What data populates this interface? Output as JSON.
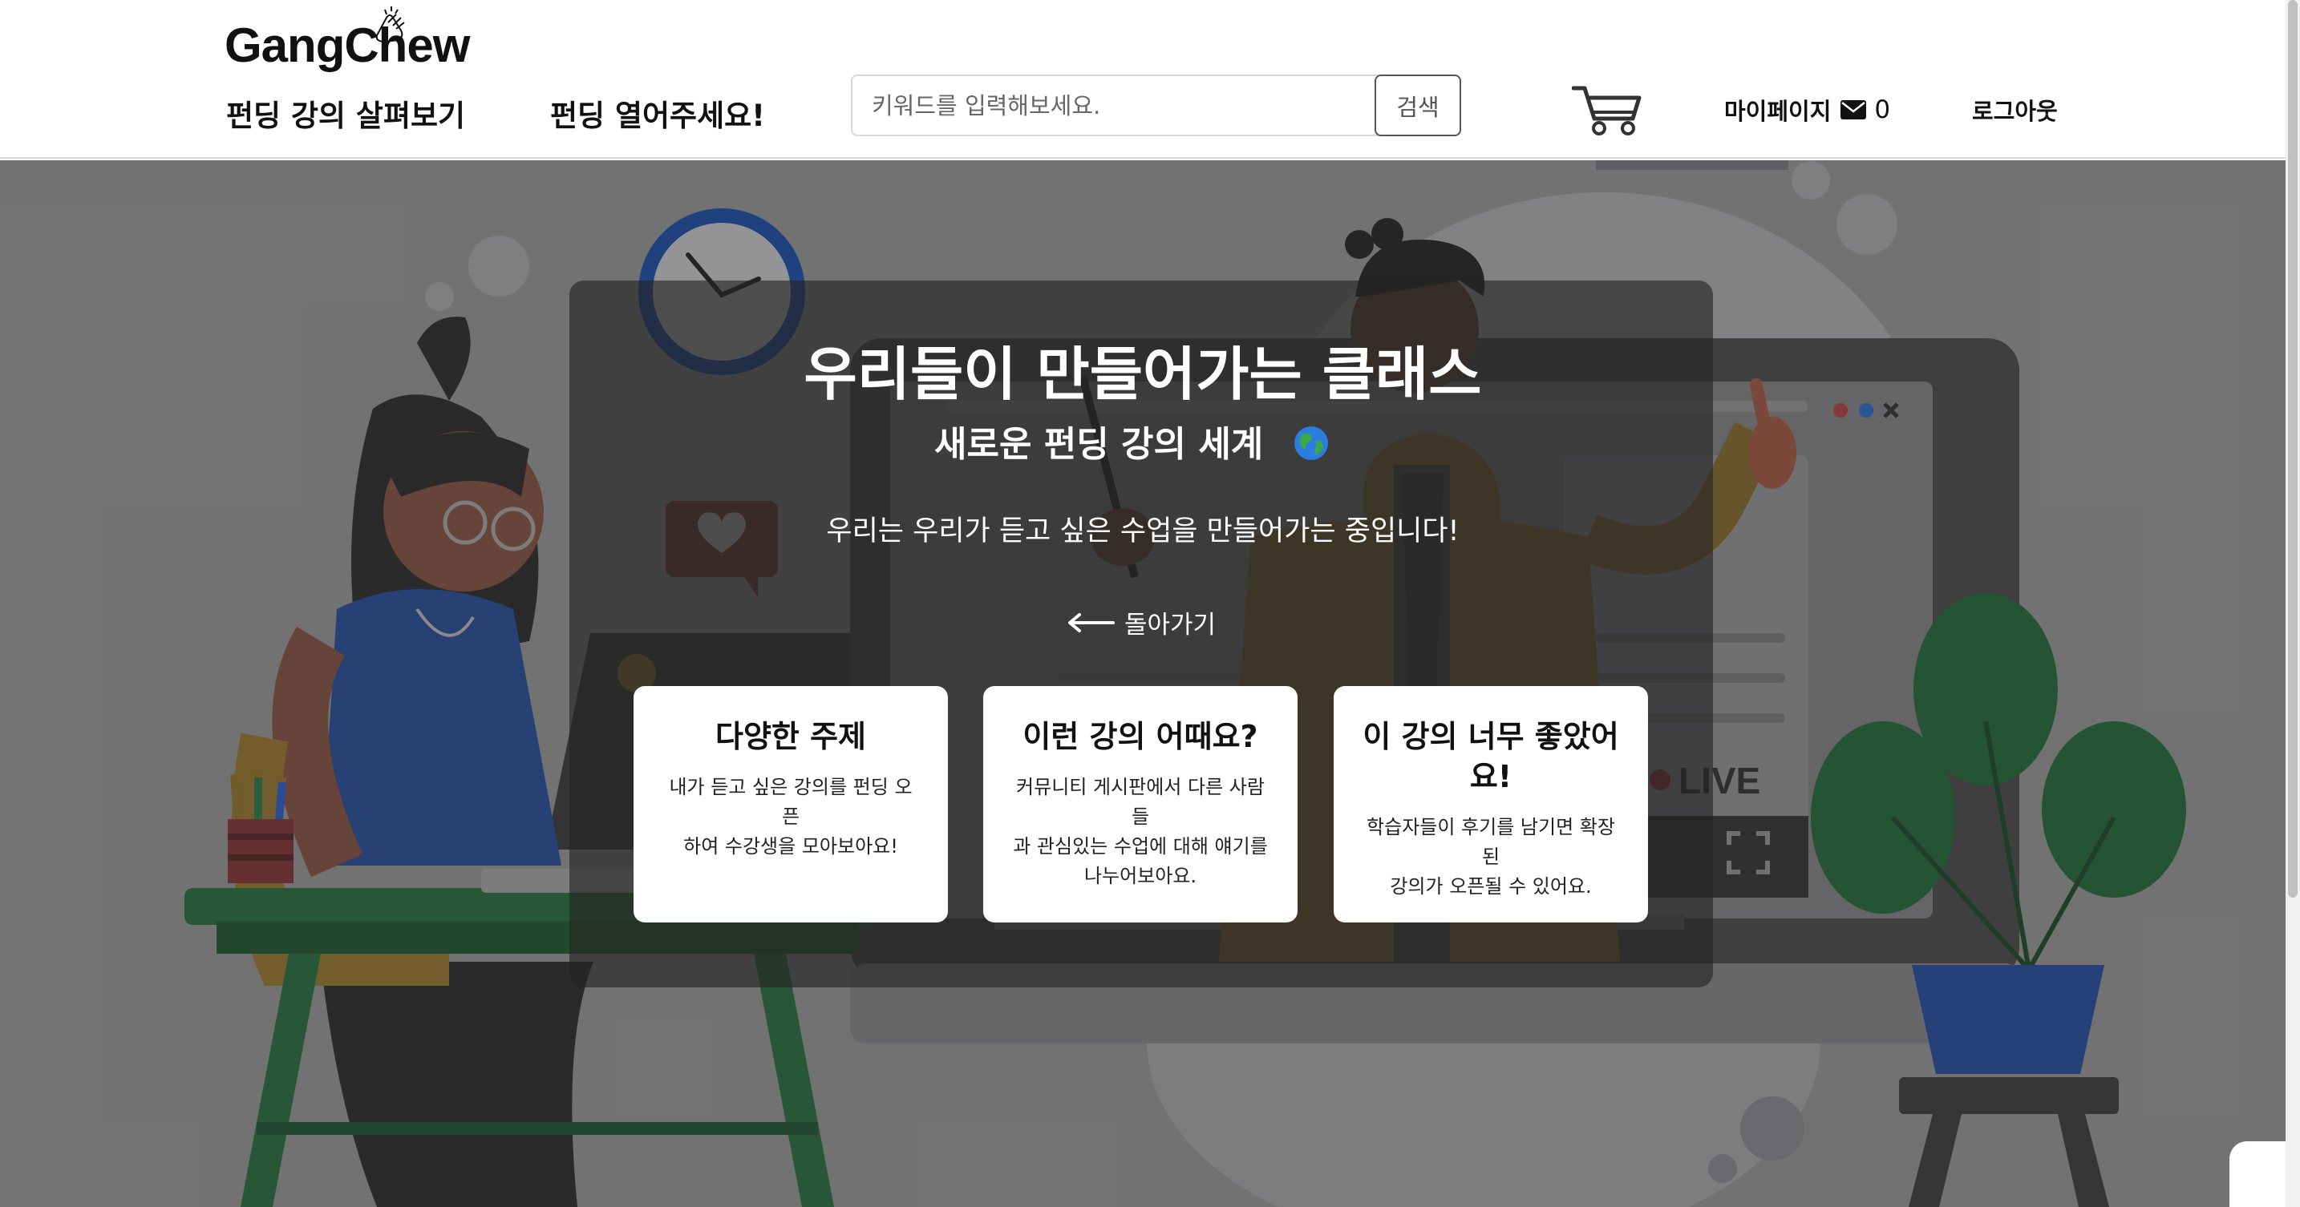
{
  "header": {
    "logo_text": "GangChew",
    "nav": {
      "browse_label": "펀딩 강의 살펴보기",
      "open_label": "펀딩 열어주세요!"
    },
    "search": {
      "placeholder": "키워드를 입력해보세요.",
      "value": "",
      "button_label": "검색"
    },
    "mypage_label": "마이페이지",
    "message_count": "0",
    "logout_label": "로그아웃",
    "icons": [
      "cart-icon",
      "mail-icon"
    ]
  },
  "hero": {
    "title": "우리들이 만들어가는 클래스",
    "subtitle": "새로운 펀딩 강의 세계",
    "subtitle_icon": "globe-icon",
    "description": "우리는 우리가 듣고 싶은 수업을 만들어가는 중입니다!",
    "back_label": "돌아가기",
    "illustration_text": {
      "live": "LIVE"
    }
  },
  "cards": [
    {
      "title": "다양한 주제",
      "desc_lines": [
        "내가 듣고 싶은 강의를 펀딩 오픈",
        "하여 수강생을 모아보아요!"
      ]
    },
    {
      "title": "이런 강의 어때요?",
      "desc_lines": [
        "커뮤니티 게시판에서 다른 사람들",
        "과 관심있는 수업에 대해 얘기를",
        "나누어보아요."
      ]
    },
    {
      "title_lines": [
        "이 강의 너무 좋았어",
        "요!"
      ],
      "desc_lines": [
        "학습자들이 후기를 남기면 확장된",
        "강의가 오픈될 수 있어요."
      ]
    }
  ],
  "colors": {
    "header_bg": "#ffffff",
    "hero_bg": "#8b8b8b",
    "card_bg": "#ffffff",
    "clock_blue": "#0b4fc6",
    "plant_green": "#1b7a3c",
    "desk_green": "#1f8a45",
    "shirt_blue": "#1e4fc4",
    "mustard": "#d49b1e"
  }
}
